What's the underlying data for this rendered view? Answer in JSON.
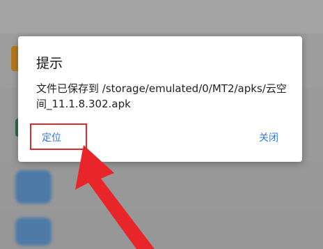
{
  "dialog": {
    "title": "提示",
    "message": "文件已保存到 /storage/emulated/0/MT2/apks/云空间_11.1.8.302.apk",
    "locate_label": "定位",
    "close_label": "关闭"
  },
  "colors": {
    "button_text": "#2f7ad8",
    "annotation_red": "#e02a2a"
  },
  "icons": [
    "annotation-arrow-icon"
  ]
}
